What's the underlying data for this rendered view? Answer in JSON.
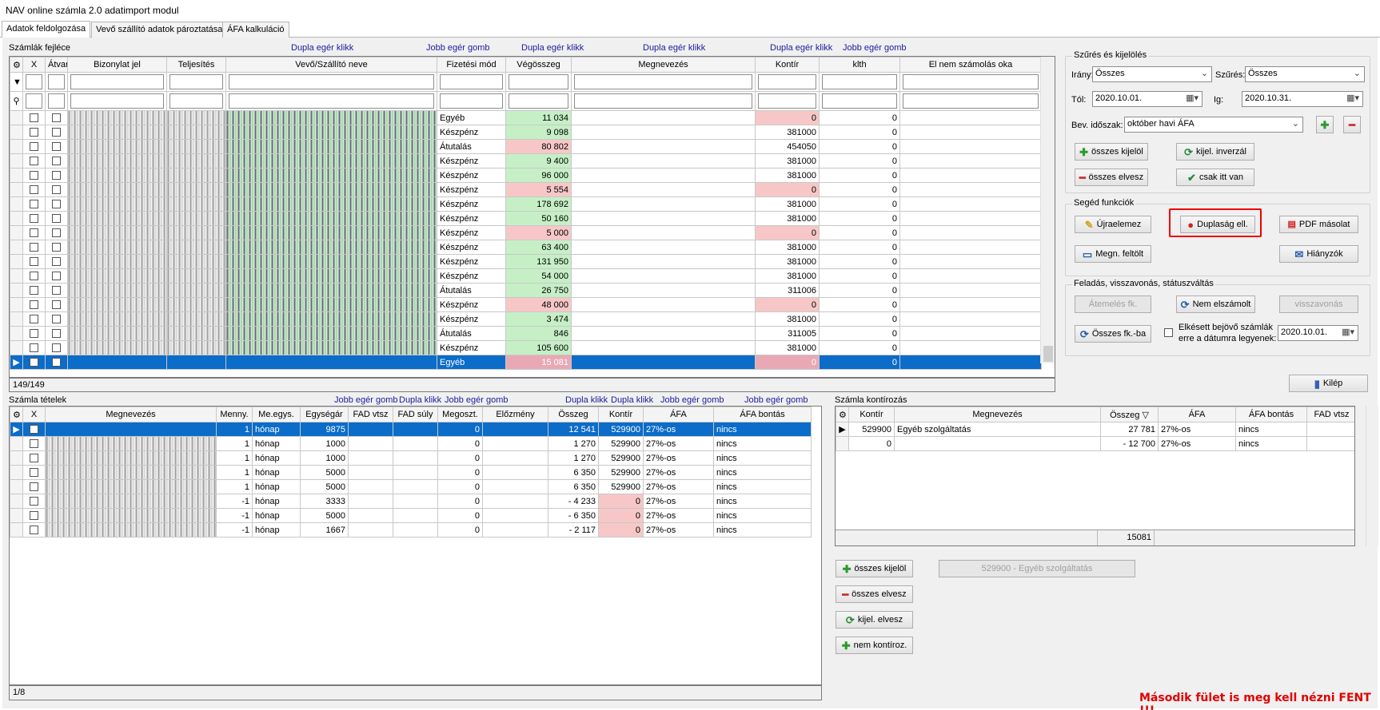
{
  "window": {
    "title": "NAV online számla 2.0 adatimport modul"
  },
  "tabs": [
    "Adatok feldolgozása",
    "Vevő szállító adatok pároztatása",
    "ÁFA kalkuláció"
  ],
  "top_grid": {
    "label": "Számlák fejléce",
    "hints": [
      "Dupla egér klikk",
      "Jobb egér gomb",
      "Dupla egér klikk",
      "Dupla egér klikk",
      "Dupla egér klikk",
      "Jobb egér gomb"
    ],
    "columns": [
      "X",
      "Átvan",
      "Bizonylat jel",
      "Teljesítés",
      "Vevő/Szállító neve",
      "Fizetési mód",
      "Végösszeg",
      "Megnevezés",
      "Kontír",
      "klth",
      "El nem számolás oka"
    ],
    "rows": [
      {
        "mode": "Egyéb",
        "total": "11 034",
        "kontir": "0",
        "klth": "0",
        "pink_total": false,
        "pink_kontir": true
      },
      {
        "mode": "Készpénz",
        "total": "9 098",
        "kontir": "381000",
        "klth": "0",
        "pink_total": false,
        "pink_kontir": false
      },
      {
        "mode": "Átutalás",
        "total": "80 802",
        "kontir": "454050",
        "klth": "0",
        "pink_total": true,
        "pink_kontir": false
      },
      {
        "mode": "Készpénz",
        "total": "9 400",
        "kontir": "381000",
        "klth": "0",
        "pink_total": false,
        "pink_kontir": false
      },
      {
        "mode": "Készpénz",
        "total": "96 000",
        "kontir": "381000",
        "klth": "0",
        "pink_total": false,
        "pink_kontir": false
      },
      {
        "mode": "Készpénz",
        "total": "5 554",
        "kontir": "0",
        "klth": "0",
        "pink_total": true,
        "pink_kontir": true
      },
      {
        "mode": "Készpénz",
        "total": "178 692",
        "kontir": "381000",
        "klth": "0",
        "pink_total": false,
        "pink_kontir": false
      },
      {
        "mode": "Készpénz",
        "total": "50 160",
        "kontir": "381000",
        "klth": "0",
        "pink_total": false,
        "pink_kontir": false
      },
      {
        "mode": "Készpénz",
        "total": "5 000",
        "kontir": "0",
        "klth": "0",
        "pink_total": true,
        "pink_kontir": true
      },
      {
        "mode": "Készpénz",
        "total": "63 400",
        "kontir": "381000",
        "klth": "0",
        "pink_total": false,
        "pink_kontir": false
      },
      {
        "mode": "Készpénz",
        "total": "131 950",
        "kontir": "381000",
        "klth": "0",
        "pink_total": false,
        "pink_kontir": false
      },
      {
        "mode": "Készpénz",
        "total": "54 000",
        "kontir": "381000",
        "klth": "0",
        "pink_total": false,
        "pink_kontir": false
      },
      {
        "mode": "Átutalás",
        "total": "26 750",
        "kontir": "311006",
        "klth": "0",
        "pink_total": false,
        "pink_kontir": false
      },
      {
        "mode": "Készpénz",
        "total": "48 000",
        "kontir": "0",
        "klth": "0",
        "pink_total": true,
        "pink_kontir": true
      },
      {
        "mode": "Készpénz",
        "total": "3 474",
        "kontir": "381000",
        "klth": "0",
        "pink_total": false,
        "pink_kontir": false
      },
      {
        "mode": "Átutalás",
        "total": "846",
        "kontir": "311005",
        "klth": "0",
        "pink_total": false,
        "pink_kontir": false
      },
      {
        "mode": "Készpénz",
        "total": "105 600",
        "kontir": "381000",
        "klth": "0",
        "pink_total": false,
        "pink_kontir": false
      },
      {
        "mode": "Egyéb",
        "total": "15 081",
        "kontir": "0",
        "klth": "0",
        "pink_total": true,
        "pink_kontir": true,
        "selected": true
      }
    ],
    "count": "149/149"
  },
  "filter": {
    "group_title": "Szűrés és kijelölés",
    "direction_label": "Irány:",
    "direction_value": "Összes",
    "filter_label": "Szűrés:",
    "filter_value": "Összes",
    "from_label": "Tól:",
    "from_value": "2020.10.01.",
    "to_label": "Ig:",
    "to_value": "2020.10.31.",
    "period_label": "Bev. időszak:",
    "period_value": "október havi ÁFA",
    "select_all": "összes kijelöl",
    "invert": "kijel. inverzál",
    "deselect_all": "összes elvesz",
    "only_here": "csak itt van"
  },
  "helper": {
    "group_title": "Segéd funkciók",
    "reparse": "Újraelemez",
    "duplicate_check": "Duplaság ell.",
    "pdf_copy": "PDF másolat",
    "upload_names": "Megn. feltölt",
    "missing": "Hiányzók"
  },
  "posting": {
    "group_title": "Feladás, visszavonás, státuszváltás",
    "transfer": "Átemelés fk.",
    "not_settled": "Nem elszámolt",
    "revoke": "visszavonás",
    "all_to_ledger": "Összes fk.-ba",
    "late_label_1": "Elkésett bejövő számlák",
    "late_label_2": "erre a dátumra legyenek:",
    "late_date": "2020.10.01."
  },
  "exit": "Kilép",
  "items_grid": {
    "label": "Számla tételek",
    "hints": [
      "Jobb egér gomb",
      "Dupla klikk",
      "Jobb egér gomb",
      "Dupla klikk",
      "Dupla klikk",
      "Jobb egér gomb",
      "Jobb egér gomb"
    ],
    "columns": [
      "X",
      "Megnevezés",
      "Menny.",
      "Me.egys.",
      "Egységár",
      "FAD vtsz",
      "FAD súly",
      "Megoszt.",
      "Előzmény",
      "Összeg",
      "Kontír",
      "ÁFA",
      "ÁFA bontás"
    ],
    "rows": [
      {
        "qty": "1",
        "unit": "hónap",
        "price": "9875",
        "split": "0",
        "amount": "12 541",
        "kontir": "529900",
        "vat": "27%-os",
        "vatsplit": "nincs",
        "selected": true
      },
      {
        "qty": "1",
        "unit": "hónap",
        "price": "1000",
        "split": "0",
        "amount": "1 270",
        "kontir": "529900",
        "vat": "27%-os",
        "vatsplit": "nincs"
      },
      {
        "qty": "1",
        "unit": "hónap",
        "price": "1000",
        "split": "0",
        "amount": "1 270",
        "kontir": "529900",
        "vat": "27%-os",
        "vatsplit": "nincs"
      },
      {
        "qty": "1",
        "unit": "hónap",
        "price": "5000",
        "split": "0",
        "amount": "6 350",
        "kontir": "529900",
        "vat": "27%-os",
        "vatsplit": "nincs"
      },
      {
        "qty": "1",
        "unit": "hónap",
        "price": "5000",
        "split": "0",
        "amount": "6 350",
        "kontir": "529900",
        "vat": "27%-os",
        "vatsplit": "nincs"
      },
      {
        "qty": "-1",
        "unit": "hónap",
        "price": "3333",
        "split": "0",
        "amount": "- 4 233",
        "kontir": "0",
        "vat": "27%-os",
        "vatsplit": "nincs",
        "pink": true
      },
      {
        "qty": "-1",
        "unit": "hónap",
        "price": "5000",
        "split": "0",
        "amount": "- 6 350",
        "kontir": "0",
        "vat": "27%-os",
        "vatsplit": "nincs",
        "pink": true
      },
      {
        "qty": "-1",
        "unit": "hónap",
        "price": "1667",
        "split": "0",
        "amount": "- 2 117",
        "kontir": "0",
        "vat": "27%-os",
        "vatsplit": "nincs",
        "pink": true
      }
    ],
    "count": "1/8"
  },
  "kontir_grid": {
    "label": "Számla kontírozás",
    "columns": [
      "Kontír",
      "Megnevezés",
      "Összeg",
      "ÁFA",
      "ÁFA bontás",
      "FAD vtsz"
    ],
    "rows": [
      {
        "kontir": "529900",
        "name": "Egyéb szolgáltatás",
        "amount": "27 781",
        "vat": "27%-os",
        "vatsplit": "nincs"
      },
      {
        "kontir": "0",
        "name": "",
        "amount": "- 12 700",
        "vat": "27%-os",
        "vatsplit": "nincs"
      }
    ],
    "sum": "15081"
  },
  "kontir_buttons": {
    "select_all": "összes kijelöl",
    "deselect_all": "összes elvesz",
    "deselect_sel": "kijel. elvesz",
    "no_kontir": "nem kontíroz.",
    "assign": "529900 - Egyéb szolgáltatás"
  },
  "note": "Második fület is meg kell nézni FENT !!!"
}
